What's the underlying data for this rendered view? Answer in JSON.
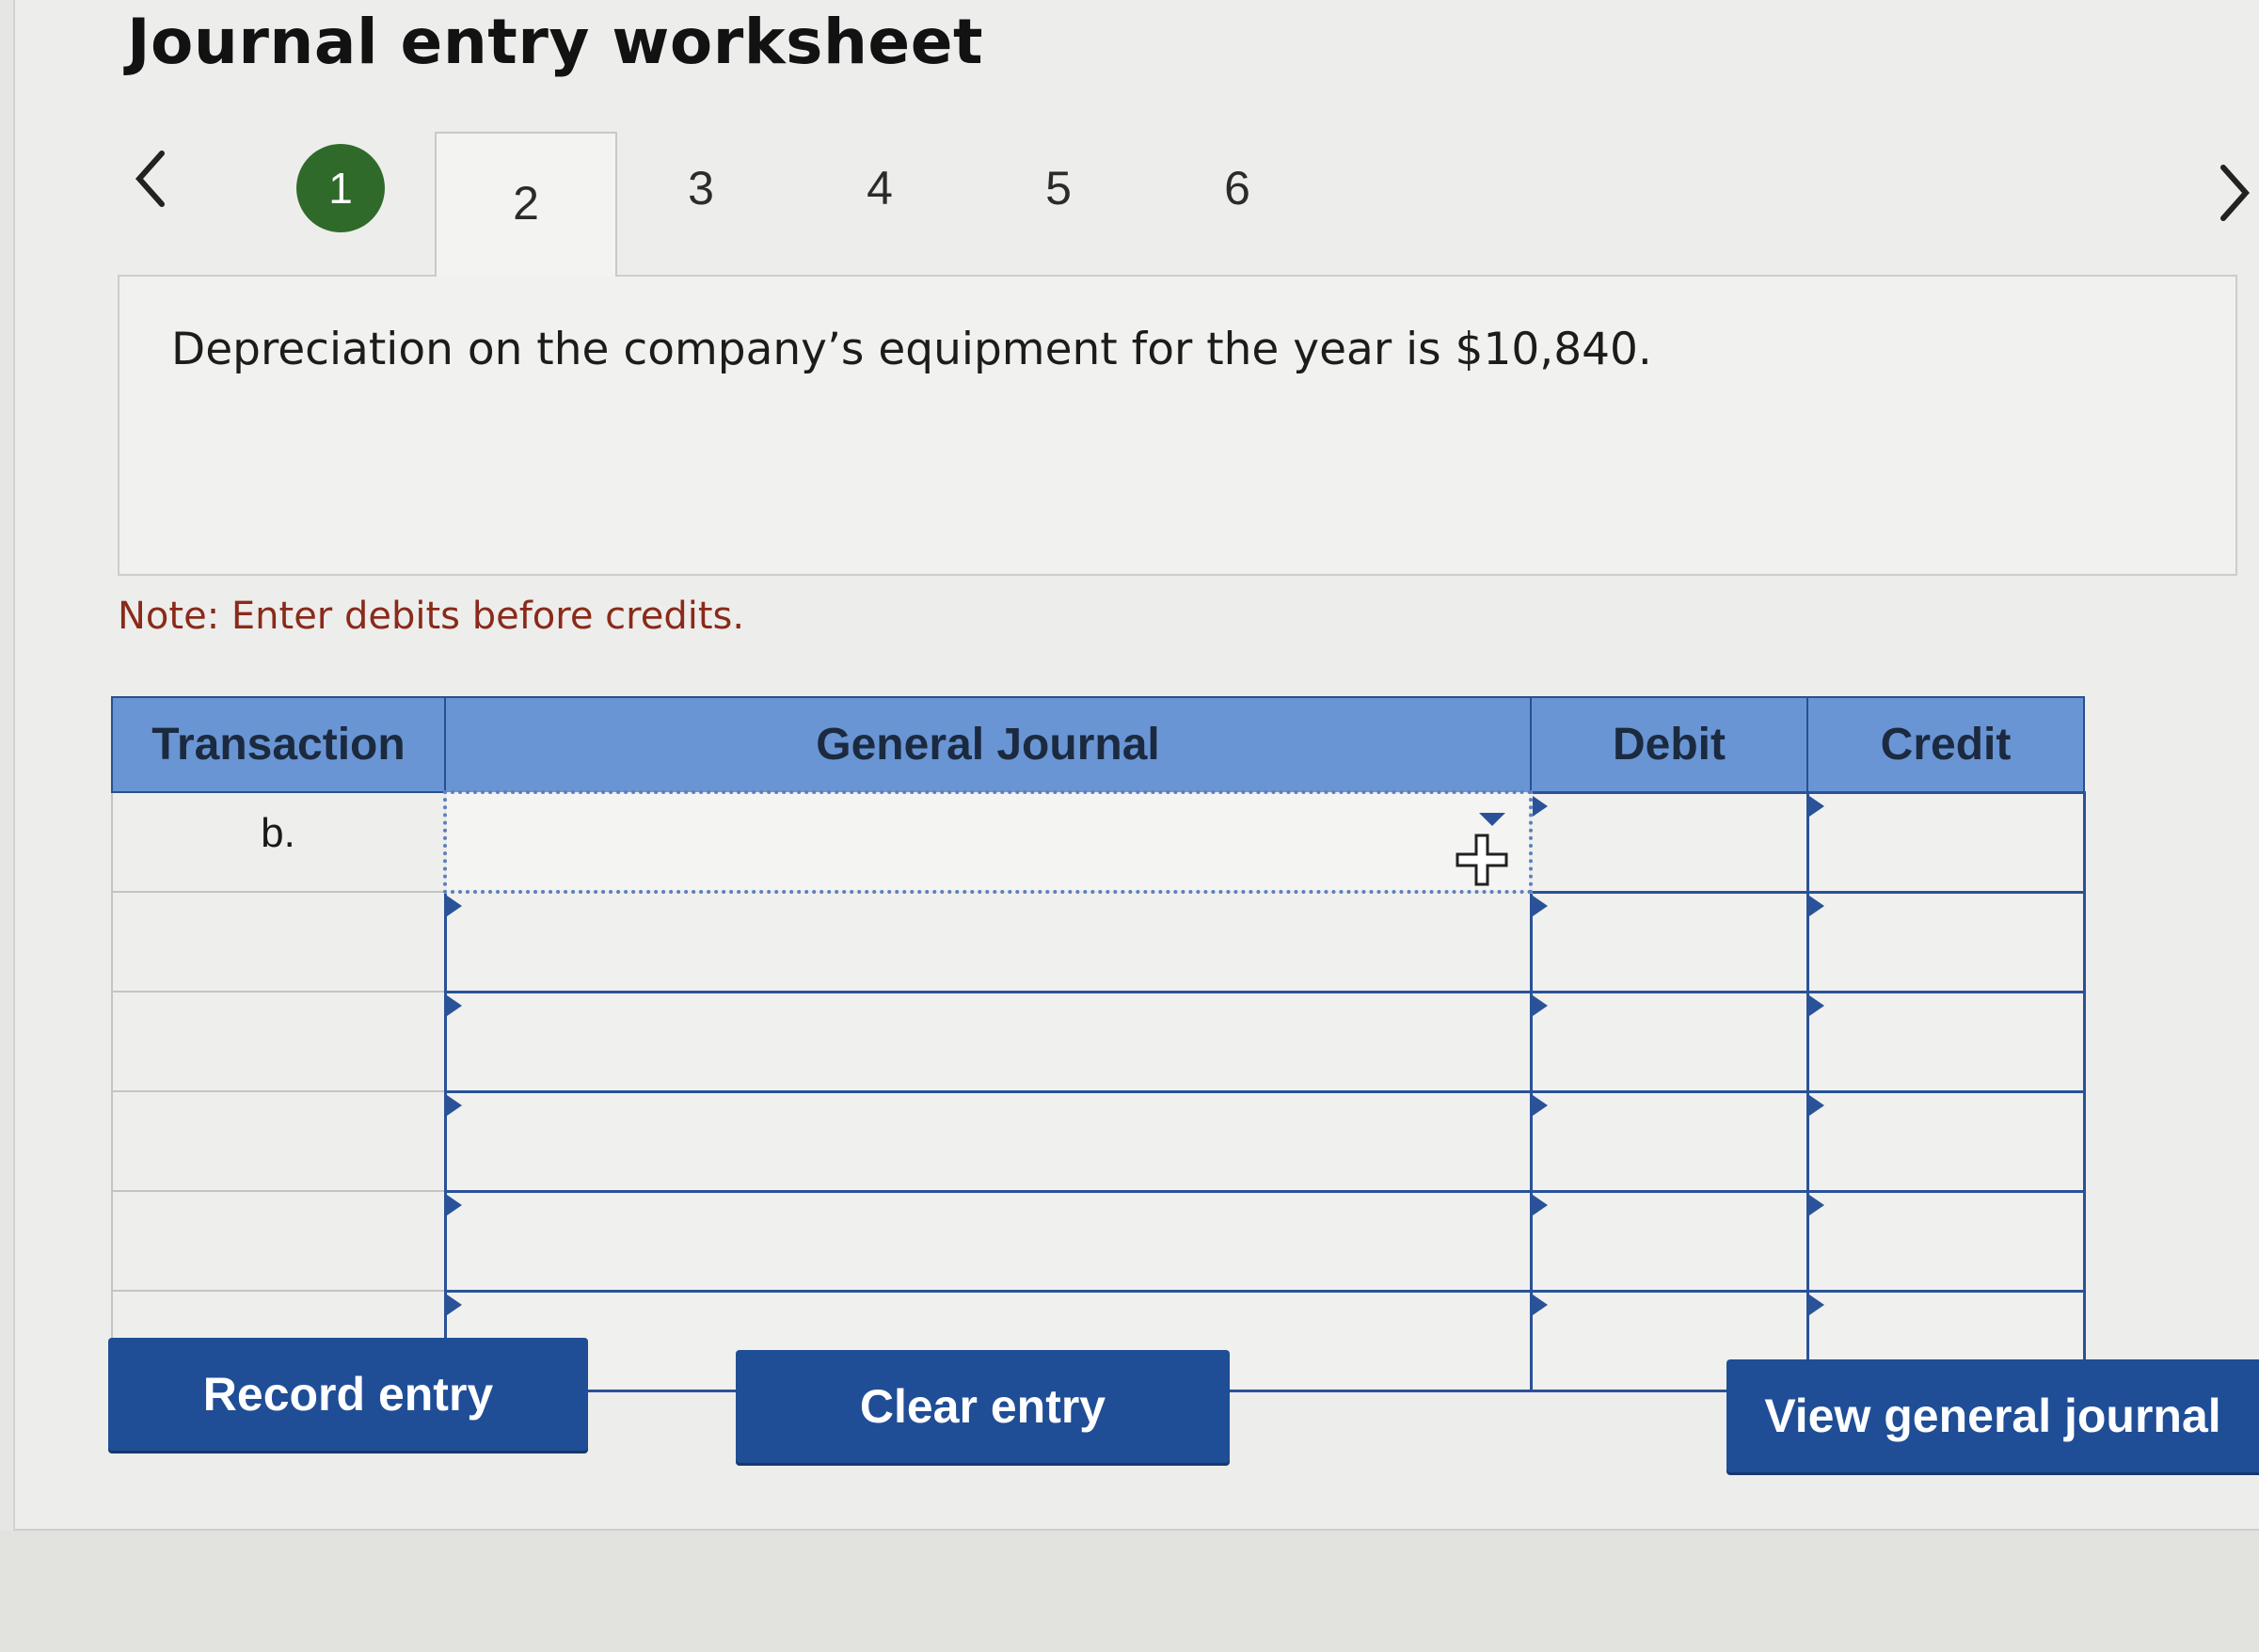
{
  "page": {
    "title": "Journal entry worksheet"
  },
  "nav": {
    "prev_icon": "chevron-left-icon",
    "next_icon": "chevron-right-icon",
    "steps": [
      {
        "label": "1",
        "state": "completed"
      },
      {
        "label": "2",
        "state": "active"
      },
      {
        "label": "3",
        "state": "default"
      },
      {
        "label": "4",
        "state": "default"
      },
      {
        "label": "5",
        "state": "default"
      },
      {
        "label": "6",
        "state": "default"
      }
    ]
  },
  "description": "Depreciation on the company’s equipment for the year is $10,840.",
  "note": "Note: Enter debits before credits.",
  "table": {
    "headers": {
      "transaction": "Transaction",
      "general_journal": "General Journal",
      "debit": "Debit",
      "credit": "Credit"
    },
    "rows": [
      {
        "transaction": "b.",
        "account": "",
        "debit": "",
        "credit": ""
      },
      {
        "transaction": "",
        "account": "",
        "debit": "",
        "credit": ""
      },
      {
        "transaction": "",
        "account": "",
        "debit": "",
        "credit": ""
      },
      {
        "transaction": "",
        "account": "",
        "debit": "",
        "credit": ""
      },
      {
        "transaction": "",
        "account": "",
        "debit": "",
        "credit": ""
      },
      {
        "transaction": "",
        "account": "",
        "debit": "",
        "credit": ""
      }
    ]
  },
  "buttons": {
    "record": "Record entry",
    "clear": "Clear entry",
    "view": "View general journal"
  },
  "colors": {
    "header_bg": "#6a95d4",
    "button_bg": "#1f4e96",
    "step_done": "#2f6a2a",
    "note_text": "#8a2a1a"
  }
}
